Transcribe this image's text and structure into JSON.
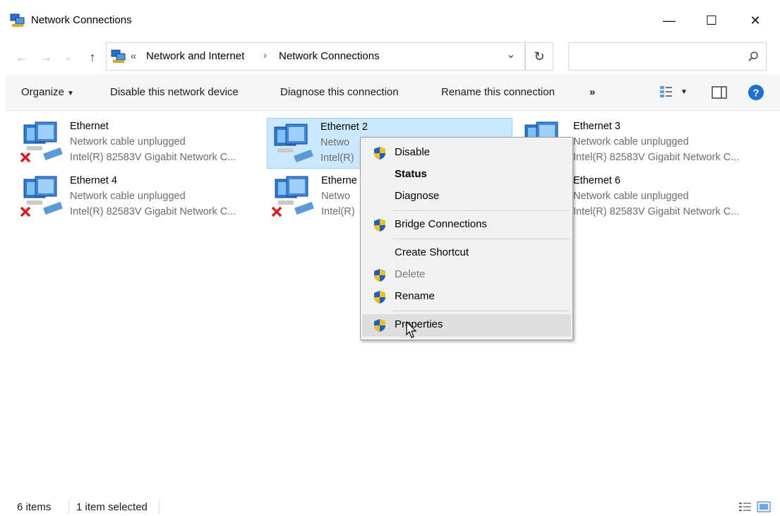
{
  "window": {
    "title": "Network Connections",
    "minimize": "—",
    "maximize": "☐",
    "close": "✕"
  },
  "address": {
    "back": "←",
    "forward": "→",
    "recent": "⌄",
    "up": "↑",
    "overflow": "«",
    "crumbs": [
      "Network and Internet",
      "Network Connections"
    ],
    "sep": "›",
    "dropdown": "⌄",
    "refresh": "↻",
    "search_placeholder": ""
  },
  "commands": {
    "organize": "Organize",
    "disable": "Disable this network device",
    "diagnose": "Diagnose this connection",
    "rename": "Rename this connection",
    "more": "»"
  },
  "items": [
    {
      "name": "Ethernet",
      "status": "Network cable unplugged",
      "adapter": "Intel(R) 82583V Gigabit Network C...",
      "unplugged": true
    },
    {
      "name": "Ethernet 2",
      "status": "Netwo",
      "adapter": "Intel(R)",
      "unplugged": false,
      "selected": true
    },
    {
      "name": "Ethernet 3",
      "status": "Network cable unplugged",
      "adapter": "Intel(R) 82583V Gigabit Network C...",
      "unplugged": false
    },
    {
      "name": "Ethernet 4",
      "status": "Network cable unplugged",
      "adapter": "Intel(R) 82583V Gigabit Network C...",
      "unplugged": true
    },
    {
      "name": "Etherne",
      "status": "Netwo",
      "adapter": "Intel(R)",
      "unplugged": true
    },
    {
      "name": "Ethernet 6",
      "status": "Network cable unplugged",
      "adapter": "Intel(R) 82583V Gigabit Network C...",
      "unplugged": false
    }
  ],
  "context_menu": {
    "disable": "Disable",
    "status": "Status",
    "diagnose": "Diagnose",
    "bridge": "Bridge Connections",
    "shortcut": "Create Shortcut",
    "delete": "Delete",
    "rename": "Rename",
    "properties": "Properties"
  },
  "statusbar": {
    "count": "6 items",
    "selected": "1 item selected"
  },
  "colors": {
    "selection": "#cce8ff",
    "help": "#1e6fd1",
    "error_x": "#d32020"
  }
}
